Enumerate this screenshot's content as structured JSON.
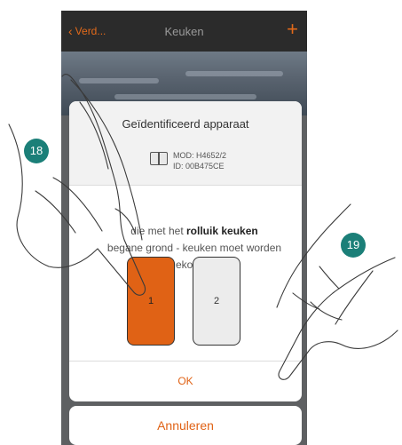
{
  "header": {
    "back_label": "Verd...",
    "title": "Keuken",
    "add_label": "+"
  },
  "dialog": {
    "title": "Geïdentificeerd apparaat",
    "device_model": "MOD: H4652/2",
    "device_id": "ID: 00B475CE",
    "message_prefix": "die met het",
    "message_bold": "rolluik keuken",
    "message_line2": "begane grond - keuken moet worden",
    "message_line3": "gekoppeld",
    "key1_label": "1",
    "key2_label": "2",
    "ok_label": "OK"
  },
  "cancel_label": "Annuleren",
  "steps": {
    "step_a": "18",
    "step_b": "19"
  },
  "colors": {
    "accent": "#e06215",
    "step_badge": "#1b7f78",
    "topbar": "#2b2b2b"
  },
  "icons": {
    "back": "chevron-left-icon",
    "add": "plus-icon",
    "device": "device-icon"
  }
}
